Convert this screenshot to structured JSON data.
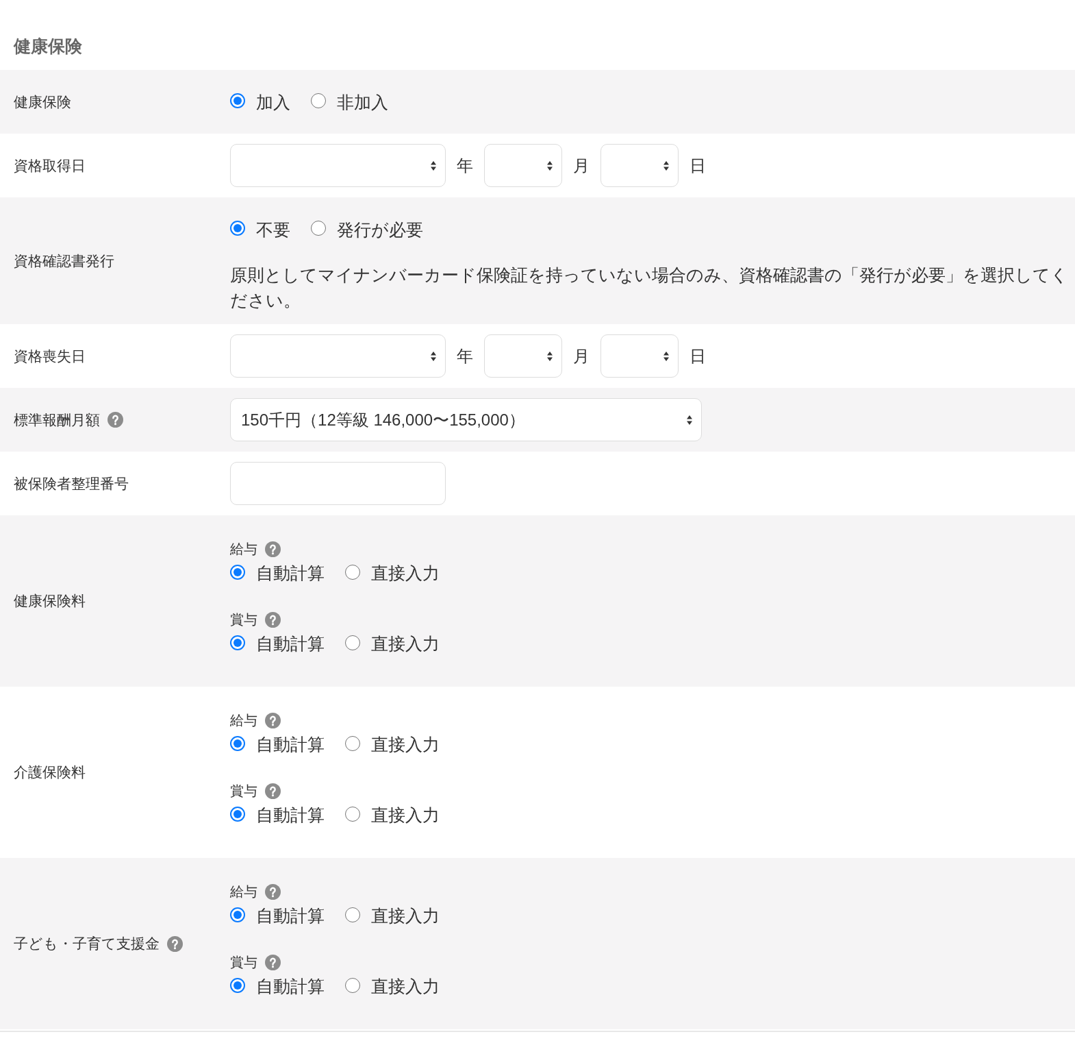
{
  "heading": "健康保険",
  "rows": [
    {
      "label": "健康保険",
      "kind": "radio",
      "options": [
        {
          "label": "加入",
          "selected": true
        },
        {
          "label": "非加入",
          "selected": false
        }
      ]
    },
    {
      "label": "資格取得日",
      "kind": "date",
      "parts": [
        {
          "unit": "年"
        },
        {
          "unit": "月"
        },
        {
          "unit": "日"
        }
      ]
    },
    {
      "label": "資格確認書発行",
      "kind": "radio",
      "options": [
        {
          "label": "不要",
          "selected": true
        },
        {
          "label": "発行が必要",
          "selected": false
        }
      ],
      "note": "原則としてマイナンバーカード保険証を持っていない場合のみ、資格確認書の「発行が必要」を選択してください。"
    },
    {
      "label": "資格喪失日",
      "kind": "date",
      "parts": [
        {
          "unit": "年"
        },
        {
          "unit": "月"
        },
        {
          "unit": "日"
        }
      ]
    },
    {
      "label": "標準報酬月額",
      "help": true,
      "kind": "select",
      "value": "150千円（12等級 146,000〜155,000）"
    },
    {
      "label": "被保険者整理番号",
      "kind": "text"
    },
    {
      "label": "健康保険料",
      "kind": "groups",
      "groups": [
        {
          "title": "給与",
          "help": true,
          "options": [
            {
              "label": "自動計算",
              "selected": true
            },
            {
              "label": "直接入力",
              "selected": false
            }
          ]
        },
        {
          "title": "賞与",
          "help": true,
          "options": [
            {
              "label": "自動計算",
              "selected": true
            },
            {
              "label": "直接入力",
              "selected": false
            }
          ]
        }
      ]
    },
    {
      "label": "介護保険料",
      "kind": "groups",
      "groups": [
        {
          "title": "給与",
          "help": true,
          "options": [
            {
              "label": "自動計算",
              "selected": true
            },
            {
              "label": "直接入力",
              "selected": false
            }
          ]
        },
        {
          "title": "賞与",
          "help": true,
          "options": [
            {
              "label": "自動計算",
              "selected": true
            },
            {
              "label": "直接入力",
              "selected": false
            }
          ]
        }
      ]
    },
    {
      "label": "子ども・子育て支援金",
      "help": true,
      "kind": "groups",
      "groups": [
        {
          "title": "給与",
          "help": true,
          "options": [
            {
              "label": "自動計算",
              "selected": true
            },
            {
              "label": "直接入力",
              "selected": false
            }
          ]
        },
        {
          "title": "賞与",
          "help": true,
          "options": [
            {
              "label": "自動計算",
              "selected": true
            },
            {
              "label": "直接入力",
              "selected": false
            }
          ]
        }
      ]
    }
  ]
}
